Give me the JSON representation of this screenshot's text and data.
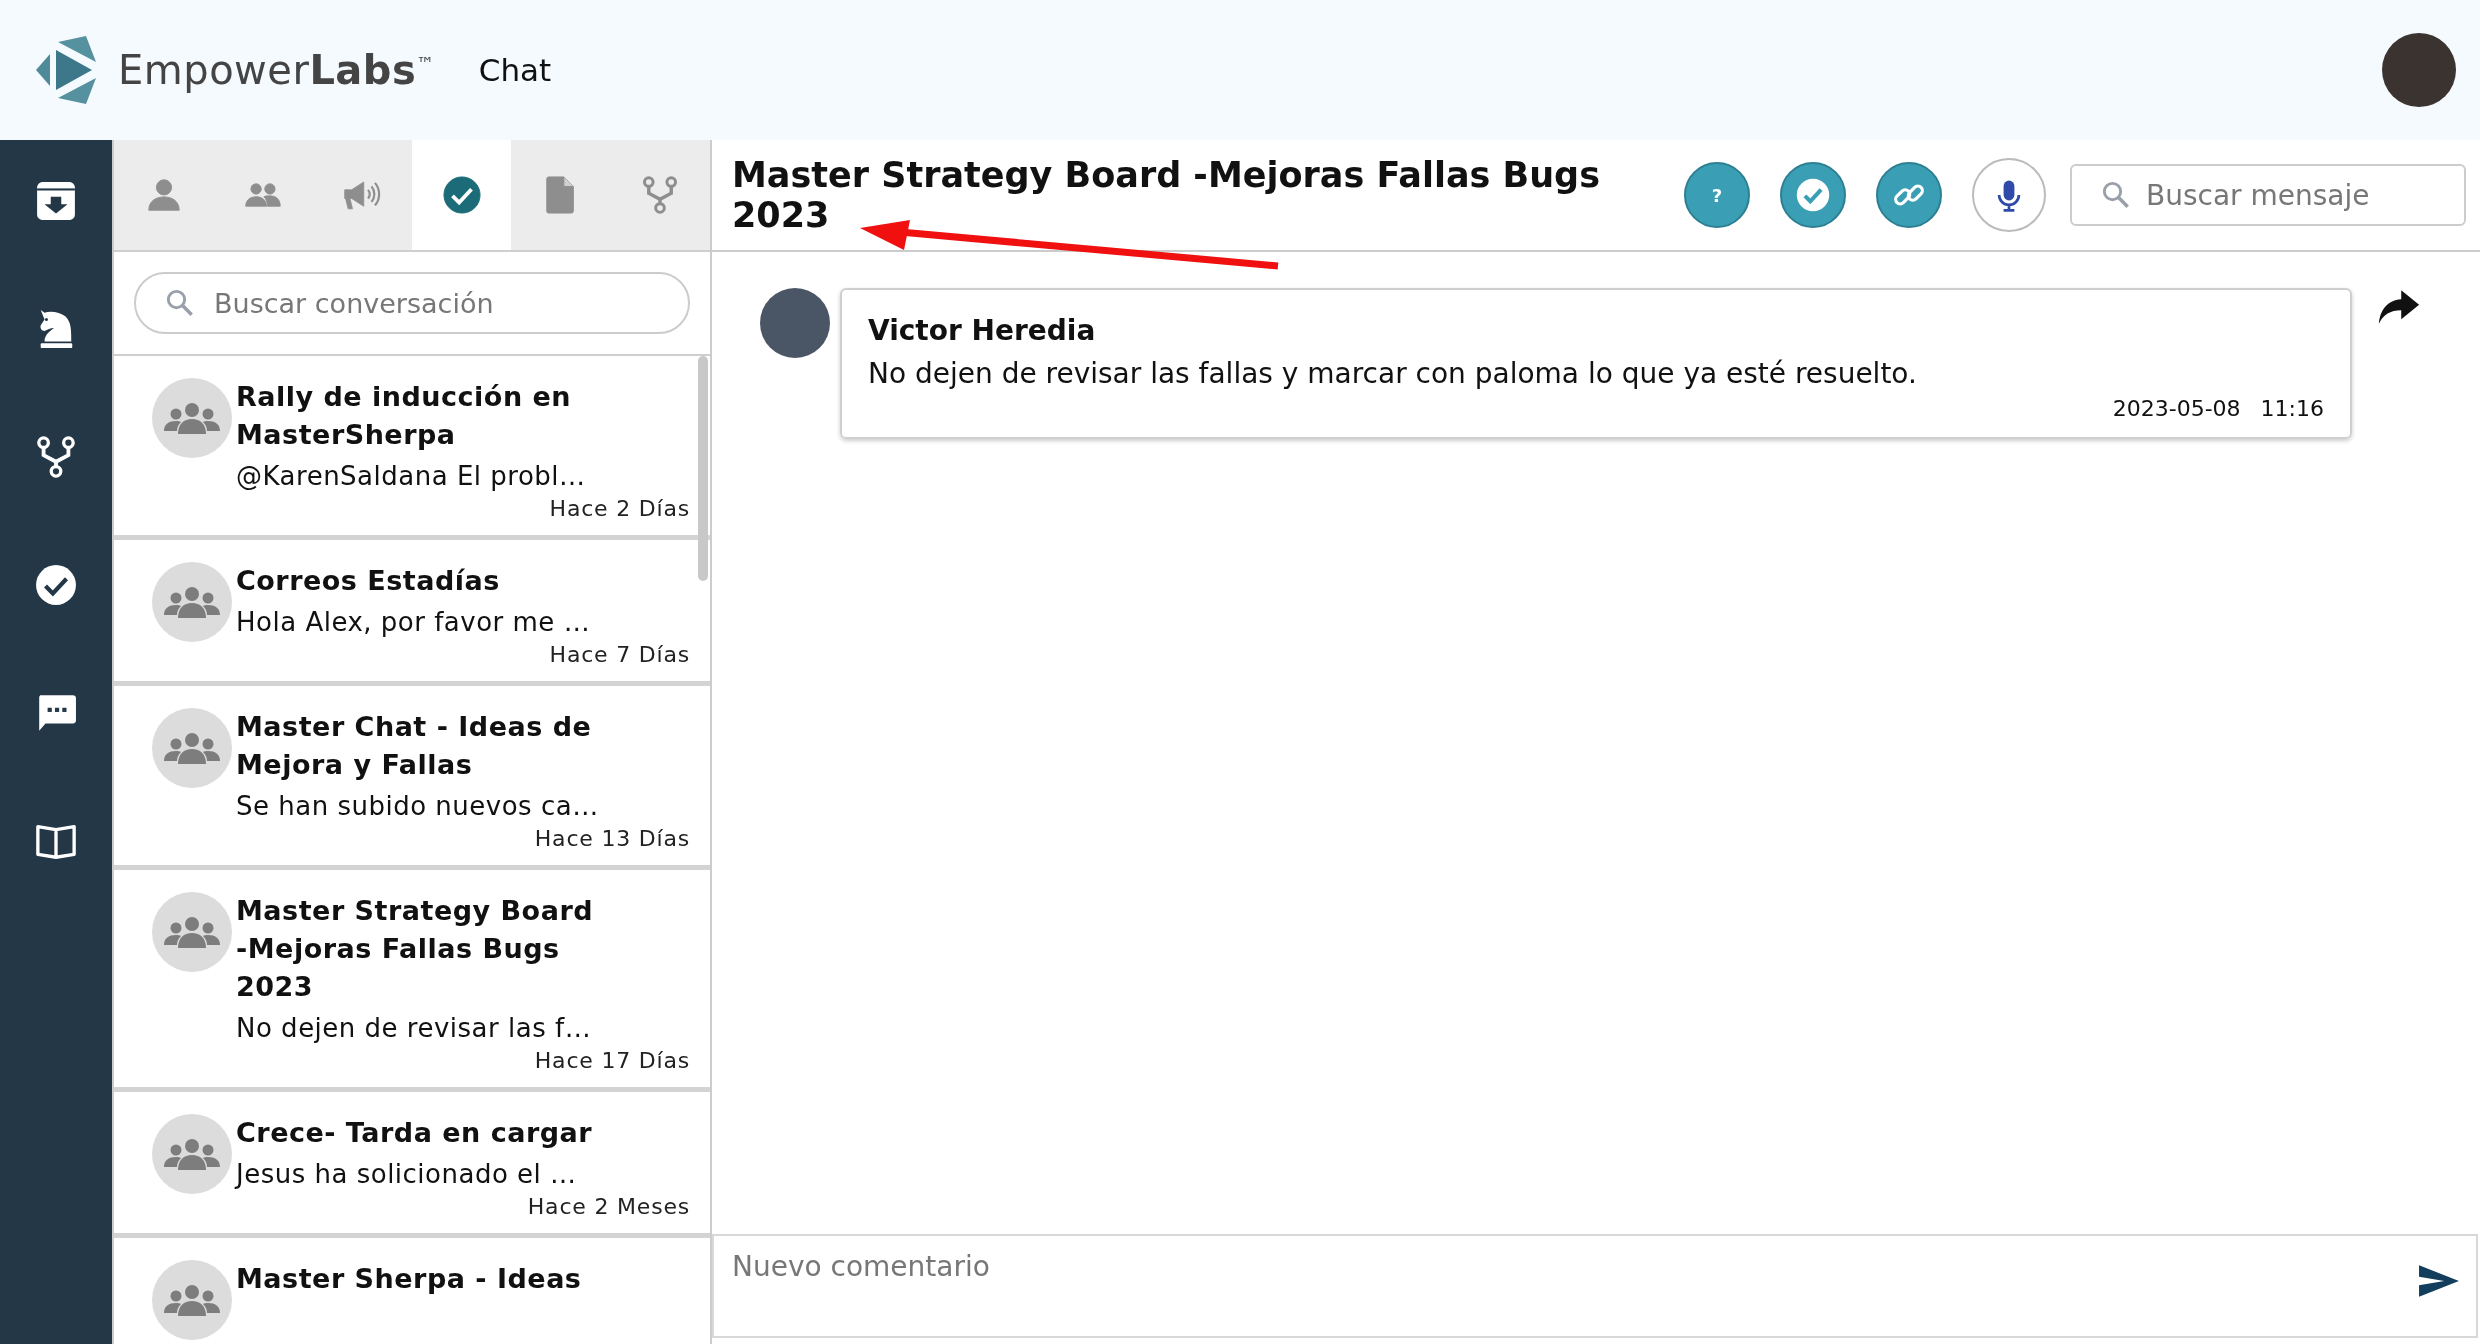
{
  "header": {
    "brand": "Empower**Labs**$^{™}$",
    "section": "Chat"
  },
  "tabs": [
    {
      "kind": "person",
      "selected": false
    },
    {
      "kind": "group",
      "selected": false
    },
    {
      "kind": "megaphone",
      "selected": false
    },
    {
      "kind": "check",
      "selected": true
    },
    {
      "kind": "file",
      "selected": false
    },
    {
      "kind": "fork",
      "selected": false
    }
  ],
  "conversation_search": {
    "placeholder": "Buscar conversación"
  },
  "conversations": [
    {
      "title": "Rally de inducción en MasterSherpa",
      "preview": "@KarenSaldana El probl…",
      "time": "Hace 2 Días"
    },
    {
      "title": "Correos Estadías",
      "preview": "Hola Alex, por favor me …",
      "time": "Hace 7 Días"
    },
    {
      "title": "Master Chat - Ideas de Mejora y Fallas",
      "preview": "Se han subido nuevos ca…",
      "time": "Hace 13 Días"
    },
    {
      "title": "Master Strategy Board -Mejoras Fallas Bugs 2023",
      "preview": "No dejen de revisar las f…",
      "time": "Hace 17 Días"
    },
    {
      "title": "Crece- Tarda en cargar",
      "preview": "Jesus ha solicionado el …",
      "time": "Hace 2 Meses"
    },
    {
      "title": "Master Sherpa - Ideas"
    }
  ],
  "chat": {
    "title": "Master Strategy Board -Mejoras Fallas Bugs 2023",
    "actions": [
      {
        "kind": "help",
        "label": "?"
      },
      {
        "kind": "check"
      },
      {
        "kind": "link"
      },
      {
        "kind": "mic"
      }
    ],
    "search": {
      "placeholder": "Buscar mensaje"
    },
    "messages": [
      {
        "author": "Victor Heredia",
        "text": "No dejen de revisar las fallas y marcar con paloma lo que ya esté resuelto.",
        "date": "2023-05-08",
        "time": "11:16"
      }
    ],
    "composer": {
      "placeholder": "Nuevo comentario"
    }
  }
}
